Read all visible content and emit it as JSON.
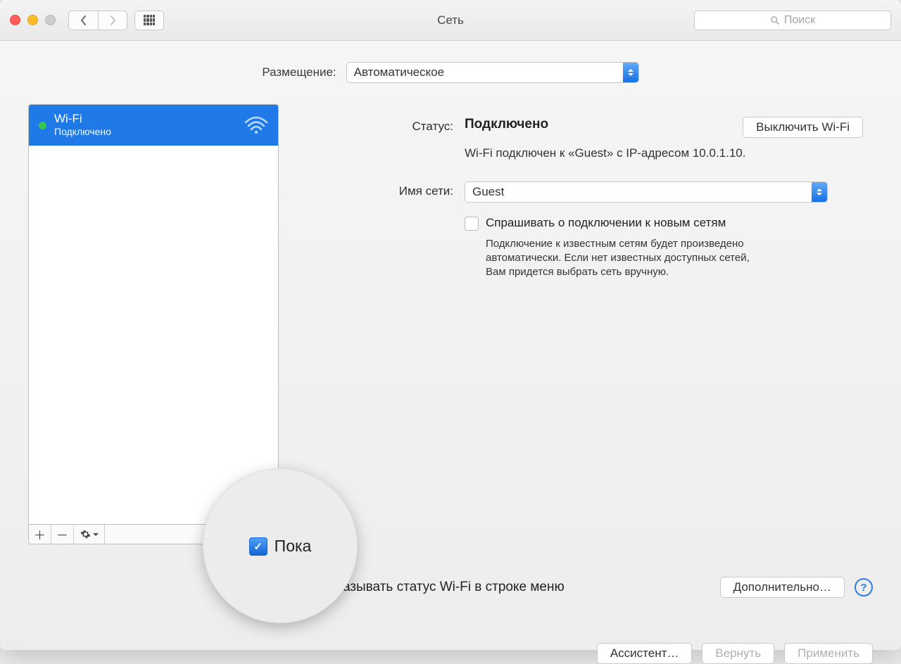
{
  "window": {
    "title": "Сеть"
  },
  "search": {
    "placeholder": "Поиск"
  },
  "location": {
    "label": "Размещение:",
    "value": "Автоматическое"
  },
  "sidebar": {
    "items": [
      {
        "name": "Wi-Fi",
        "status": "Подключено"
      }
    ]
  },
  "detail": {
    "status_label": "Статус:",
    "status_value": "Подключено",
    "wifi_off_btn": "Выключить Wi-Fi",
    "status_desc": "Wi-Fi подключен к «Guest» с IP-адресом 10.0.1.10.",
    "network_label": "Имя сети:",
    "network_value": "Guest",
    "ask_label": "Спрашивать о подключении к новым сетям",
    "ask_desc": "Подключение к известным сетям будет произведено автоматически. Если нет известных доступных сетей, Вам придется выбрать сеть вручную."
  },
  "bottom": {
    "menubar_label": "Показывать статус Wi-Fi в строке меню",
    "advanced_btn": "Дополнительно…",
    "assistant_btn": "Ассистент…",
    "revert_btn": "Вернуть",
    "apply_btn": "Применить"
  },
  "zoom": {
    "fragment": "Пока"
  }
}
